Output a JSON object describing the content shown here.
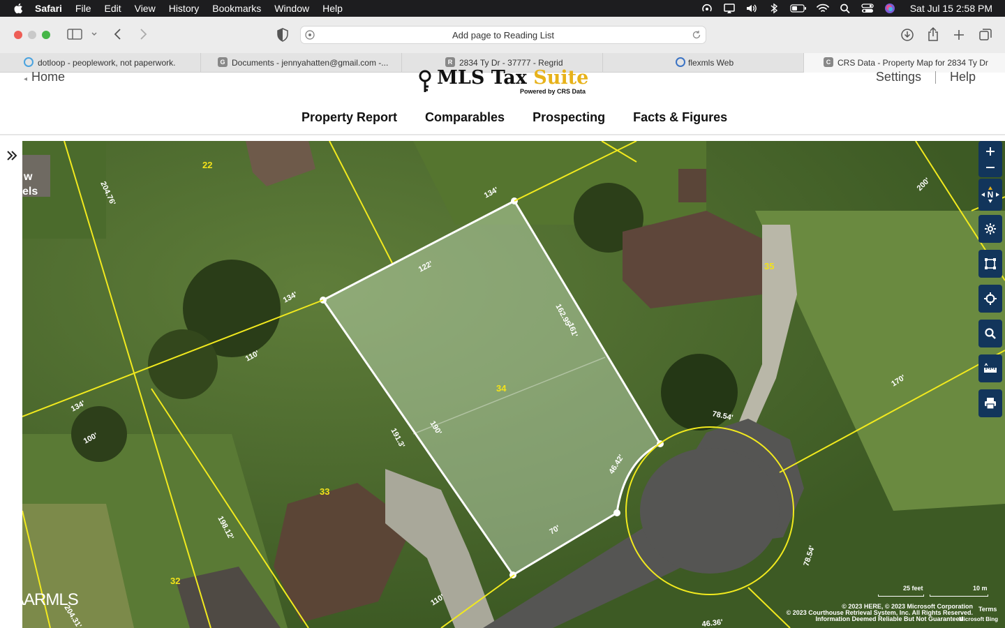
{
  "menubar": {
    "app": "Safari",
    "items": [
      "File",
      "Edit",
      "View",
      "History",
      "Bookmarks",
      "Window",
      "Help"
    ],
    "clock": "Sat Jul 15  2:58 PM"
  },
  "toolbar": {
    "address_text": "Add page to Reading List"
  },
  "tabs": [
    {
      "label": "dotloop - peoplework, not paperwork.",
      "favicon": "dotloop-icon"
    },
    {
      "label": "Documents - jennyahatten@gmail.com -...",
      "favicon_letter": "G"
    },
    {
      "label": "2834 Ty Dr - 37777 - Regrid",
      "favicon_letter": "R"
    },
    {
      "label": "flexmls Web",
      "favicon": "flexmls-icon"
    },
    {
      "label": "CRS Data - Property Map for 2834 Ty Dr",
      "favicon_letter": "C"
    }
  ],
  "header": {
    "home": "Home",
    "logo_name_1": "MLS Tax ",
    "logo_name_2": "Suite",
    "logo_tagline": "Powered by CRS Data",
    "settings": "Settings",
    "help": "Help",
    "nav": [
      "Property Report",
      "Comparables",
      "Prospecting",
      "Facts & Figures"
    ]
  },
  "map": {
    "partial_legend_1": "w",
    "partial_legend_2": "els",
    "lot_numbers": [
      "22",
      "35",
      "34",
      "33",
      "32"
    ],
    "measurements": [
      "204.76'",
      "134'",
      "122'",
      "134'",
      "110'",
      "134'",
      "100'",
      "162.95'",
      "161'",
      "190'",
      "191.3'",
      "46.42'",
      "70'",
      "78.54'",
      "170'",
      "200'",
      "198.12'",
      "204.31'",
      "110'",
      "78.54'",
      "46.36'"
    ],
    "scale_feet": "25 feet",
    "scale_m": "10 m",
    "copyright_1": "© 2023 HERE, © 2023 Microsoft Corporation",
    "copyright_2": "© 2023 Courthouse Retrieval System, Inc. All Rights Reserved.",
    "copyright_3": "Information Deemed Reliable But Not Guaranteed",
    "terms": "Terms",
    "bing": "Microsoft Bing",
    "watermark": "KAARMLS",
    "compass": "N"
  },
  "colors": {
    "parcel_line": "#f2ea1e",
    "selected_fill": "#c9e3c1",
    "tool_bg": "#12355b",
    "menubar_bg": "#1d1d1f"
  }
}
